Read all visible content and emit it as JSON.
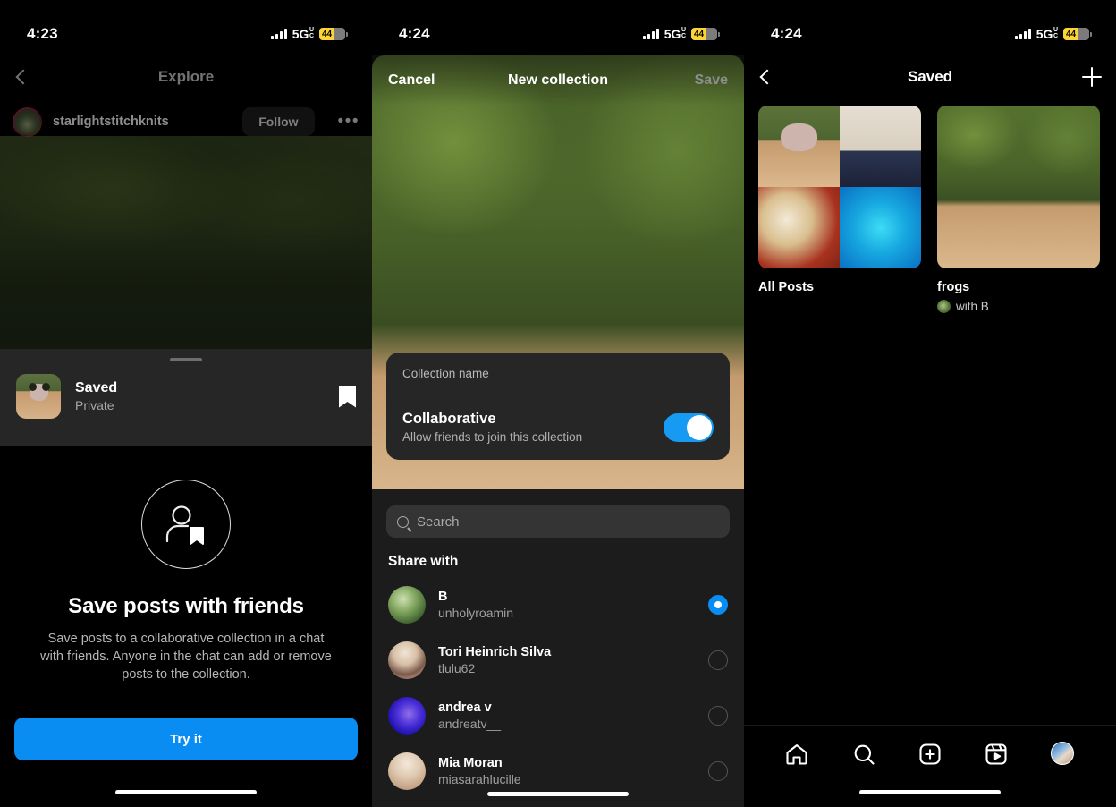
{
  "panels": [
    {
      "status": {
        "time": "4:23",
        "network": "5G",
        "network_sub": "UC",
        "battery": "44"
      },
      "nav": {
        "title": "Explore",
        "back_icon": "chevron-left-icon"
      },
      "user": {
        "username": "starlightstitchknits",
        "follow_label": "Follow",
        "more_icon": "more-options-icon"
      },
      "sheet": {
        "title": "Saved",
        "subtitle": "Private",
        "bookmark_icon": "bookmark-filled-icon"
      },
      "empty": {
        "icon": "person-bookmark-icon",
        "title": "Save posts with friends",
        "body": "Save posts to a collaborative collection in a chat with friends. Anyone in the chat can add or remove posts to the collection.",
        "cta": "Try it"
      }
    },
    {
      "status": {
        "time": "4:24",
        "network": "5G",
        "network_sub": "UC",
        "battery": "44"
      },
      "nav": {
        "cancel": "Cancel",
        "title": "New collection",
        "save": "Save"
      },
      "form": {
        "name_placeholder": "Collection name",
        "name_value": "",
        "collab_title": "Collaborative",
        "collab_sub": "Allow friends to join this collection",
        "collab_on": true
      },
      "search": {
        "placeholder": "Search",
        "icon": "search-icon"
      },
      "share_header": "Share with",
      "people": [
        {
          "name": "B",
          "handle": "unholyroamin",
          "selected": true
        },
        {
          "name": "Tori Heinrich Silva",
          "handle": "tlulu62",
          "selected": false
        },
        {
          "name": "andrea v",
          "handle": "andreatv__",
          "selected": false
        },
        {
          "name": "Mia Moran",
          "handle": "miasarahlucille",
          "selected": false
        }
      ]
    },
    {
      "status": {
        "time": "4:24",
        "network": "5G",
        "network_sub": "UC",
        "battery": "44"
      },
      "nav": {
        "title": "Saved",
        "back_icon": "chevron-left-icon",
        "add_icon": "plus-icon"
      },
      "collections": [
        {
          "name": "All Posts",
          "with": null,
          "cover": "grid"
        },
        {
          "name": "frogs",
          "with": "with B",
          "cover": "single"
        }
      ],
      "tabbar": [
        {
          "icon": "home-icon",
          "name": "tab-home"
        },
        {
          "icon": "search-icon",
          "name": "tab-search"
        },
        {
          "icon": "create-icon",
          "name": "tab-create"
        },
        {
          "icon": "reels-icon",
          "name": "tab-reels"
        },
        {
          "icon": "profile-avatar",
          "name": "tab-profile"
        }
      ]
    }
  ],
  "colors": {
    "accent": "#0a8df3",
    "toggle_on": "#179af2",
    "battery_low": "#fcd535",
    "sheet_bg": "#262626"
  }
}
